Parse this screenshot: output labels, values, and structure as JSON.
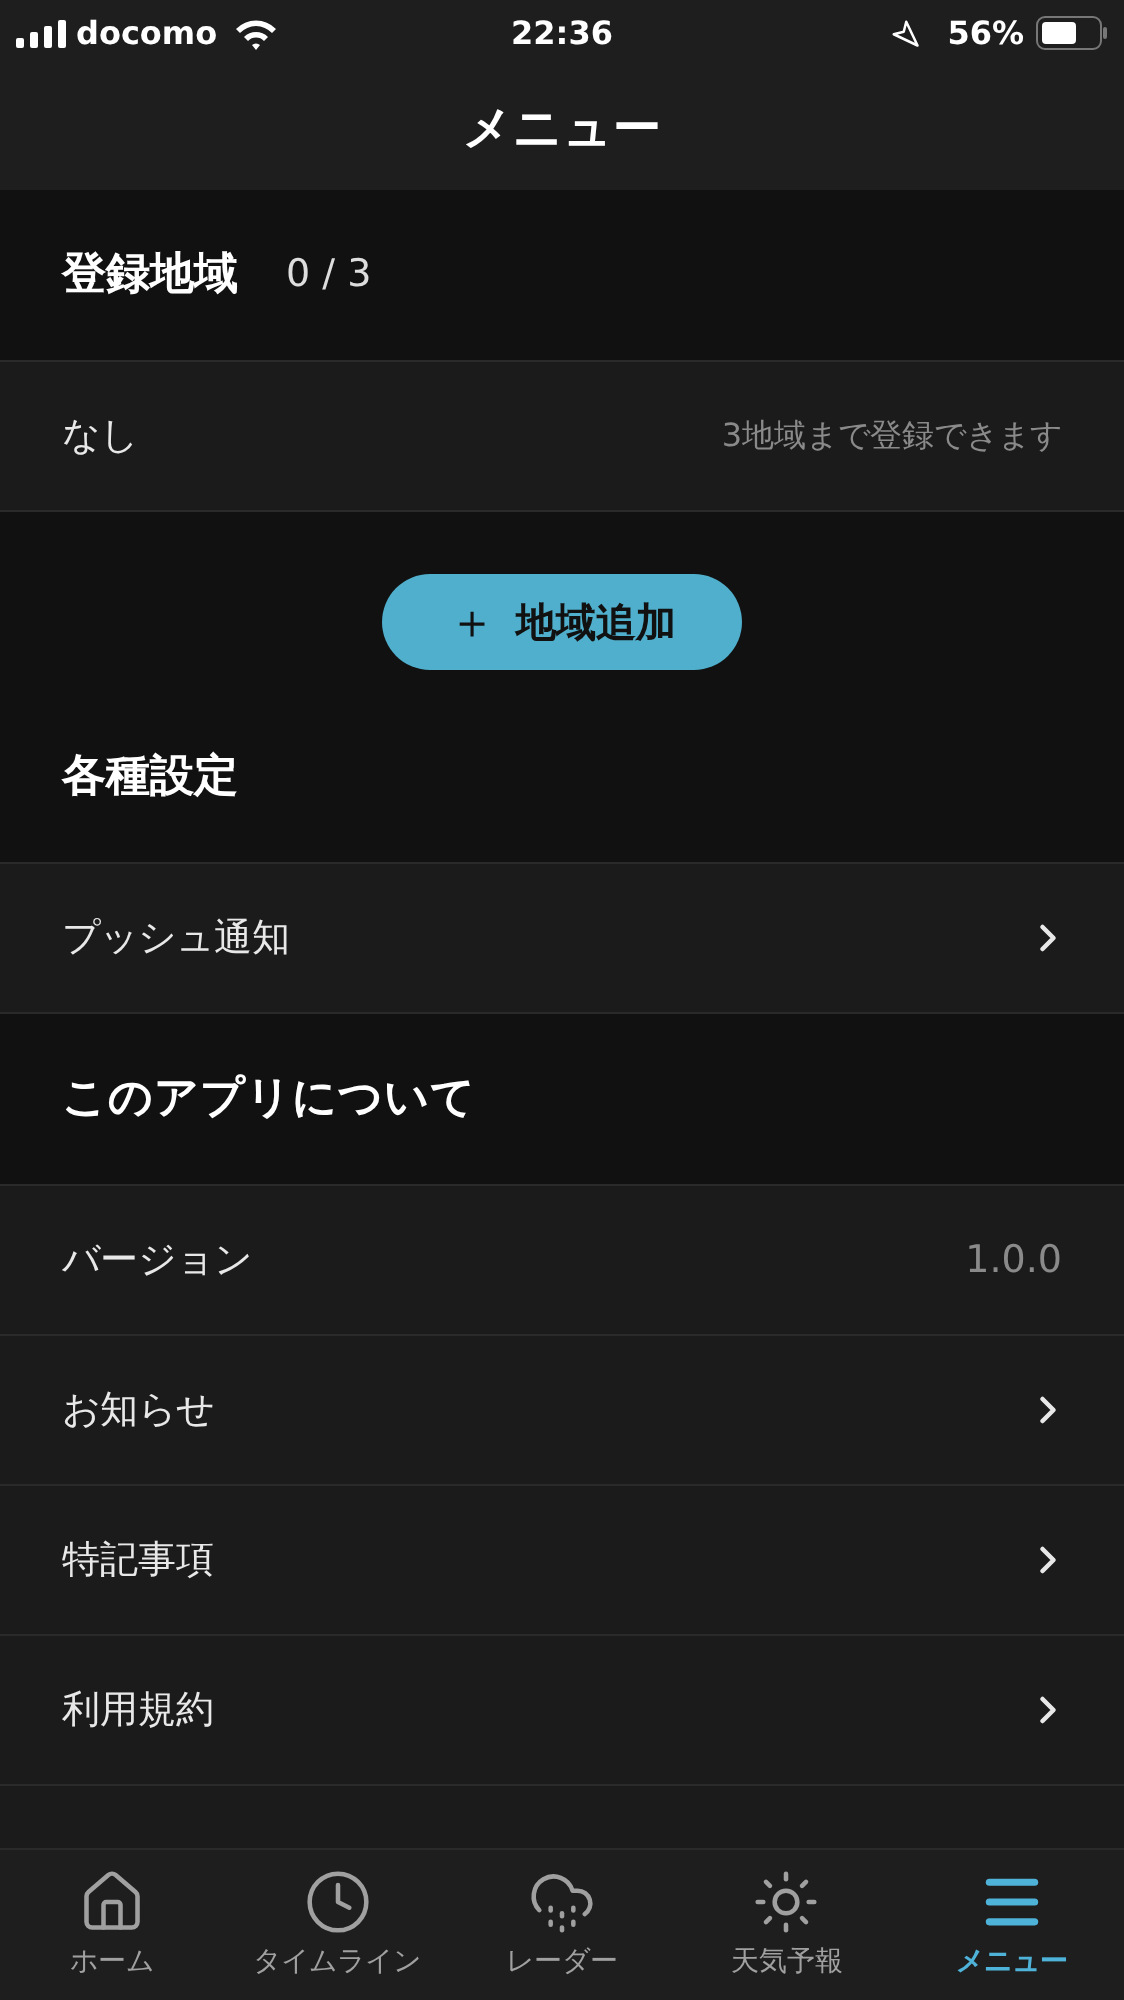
{
  "status_bar": {
    "carrier": "docomo",
    "time": "22:36",
    "battery": "56%"
  },
  "header": {
    "title": "メニュー"
  },
  "sections": [
    {
      "title": "登録地域",
      "count": "0 / 3",
      "rows": [
        {
          "kind": "value",
          "label": "なし",
          "value": "3地域まで登録できます"
        }
      ],
      "button": {
        "icon": "＋",
        "label": "地域追加"
      }
    },
    {
      "title": "各種設定",
      "rows": [
        {
          "kind": "link",
          "label": "プッシュ通知"
        }
      ]
    },
    {
      "title": "このアプリについて",
      "rows": [
        {
          "kind": "value",
          "label": "バージョン",
          "value": "1.0.0"
        },
        {
          "kind": "link",
          "label": "お知らせ"
        },
        {
          "kind": "link",
          "label": "特記事項"
        },
        {
          "kind": "link",
          "label": "利用規約"
        }
      ]
    }
  ],
  "tabs": [
    {
      "label": "ホーム",
      "selected": false
    },
    {
      "label": "タイムライン",
      "selected": false
    },
    {
      "label": "レーダー",
      "selected": false
    },
    {
      "label": "天気予報",
      "selected": false
    },
    {
      "label": "メニュー",
      "selected": true
    }
  ]
}
